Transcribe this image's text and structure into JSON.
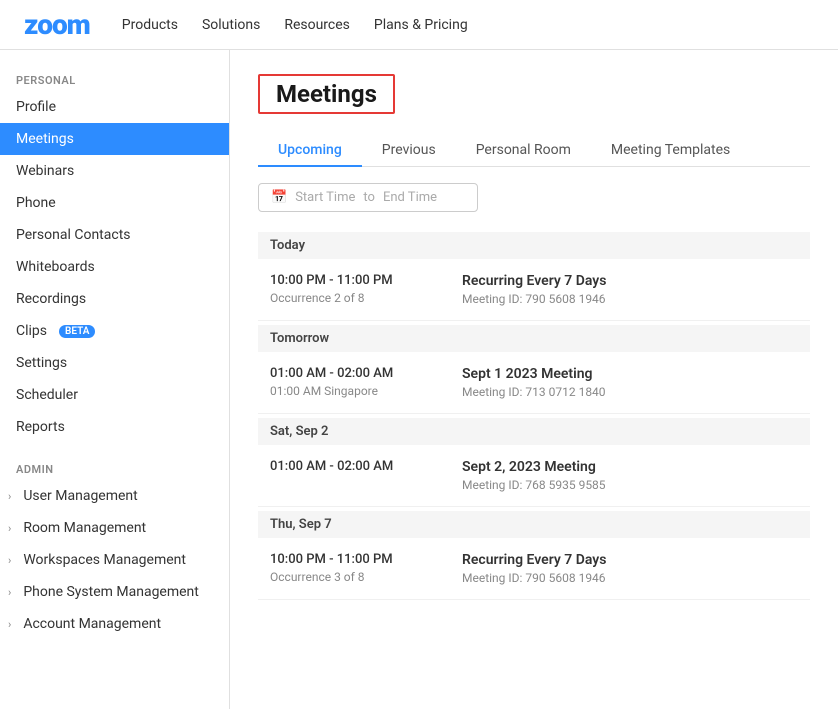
{
  "topNav": {
    "logo": "zoom",
    "links": [
      "Products",
      "Solutions",
      "Resources",
      "Plans & Pricing"
    ]
  },
  "sidebar": {
    "personal_label": "PERSONAL",
    "admin_label": "ADMIN",
    "personal_items": [
      {
        "label": "Profile",
        "active": false
      },
      {
        "label": "Meetings",
        "active": true
      },
      {
        "label": "Webinars",
        "active": false
      },
      {
        "label": "Phone",
        "active": false
      },
      {
        "label": "Personal Contacts",
        "active": false
      },
      {
        "label": "Whiteboards",
        "active": false
      },
      {
        "label": "Recordings",
        "active": false
      },
      {
        "label": "Clips",
        "active": false,
        "badge": "BETA"
      },
      {
        "label": "Settings",
        "active": false
      },
      {
        "label": "Scheduler",
        "active": false
      },
      {
        "label": "Reports",
        "active": false
      }
    ],
    "admin_items": [
      {
        "label": "User Management"
      },
      {
        "label": "Room Management"
      },
      {
        "label": "Workspaces Management"
      },
      {
        "label": "Phone System Management"
      },
      {
        "label": "Account Management"
      }
    ]
  },
  "main": {
    "page_title": "Meetings",
    "tabs": [
      {
        "label": "Upcoming",
        "active": true
      },
      {
        "label": "Previous",
        "active": false
      },
      {
        "label": "Personal Room",
        "active": false
      },
      {
        "label": "Meeting Templates",
        "active": false
      }
    ],
    "date_filter": {
      "start_placeholder": "Start Time",
      "to_label": "to",
      "end_placeholder": "End Time"
    },
    "days": [
      {
        "day_label": "Today",
        "meetings": [
          {
            "time": "10:00 PM - 11:00 PM",
            "sub": "Occurrence 2 of 8",
            "title": "Recurring Every 7 Days",
            "meeting_id": "Meeting ID: 790 5608 1946"
          }
        ]
      },
      {
        "day_label": "Tomorrow",
        "meetings": [
          {
            "time": "01:00 AM - 02:00 AM",
            "sub": "01:00 AM Singapore",
            "title": "Sept 1 2023 Meeting",
            "meeting_id": "Meeting ID: 713 0712 1840"
          }
        ]
      },
      {
        "day_label": "Sat, Sep 2",
        "meetings": [
          {
            "time": "01:00 AM - 02:00 AM",
            "sub": "",
            "title": "Sept 2, 2023 Meeting",
            "meeting_id": "Meeting ID: 768 5935 9585"
          }
        ]
      },
      {
        "day_label": "Thu, Sep 7",
        "meetings": [
          {
            "time": "10:00 PM - 11:00 PM",
            "sub": "Occurrence 3 of 8",
            "title": "Recurring Every 7 Days",
            "meeting_id": "Meeting ID: 790 5608 1946"
          }
        ]
      }
    ]
  }
}
